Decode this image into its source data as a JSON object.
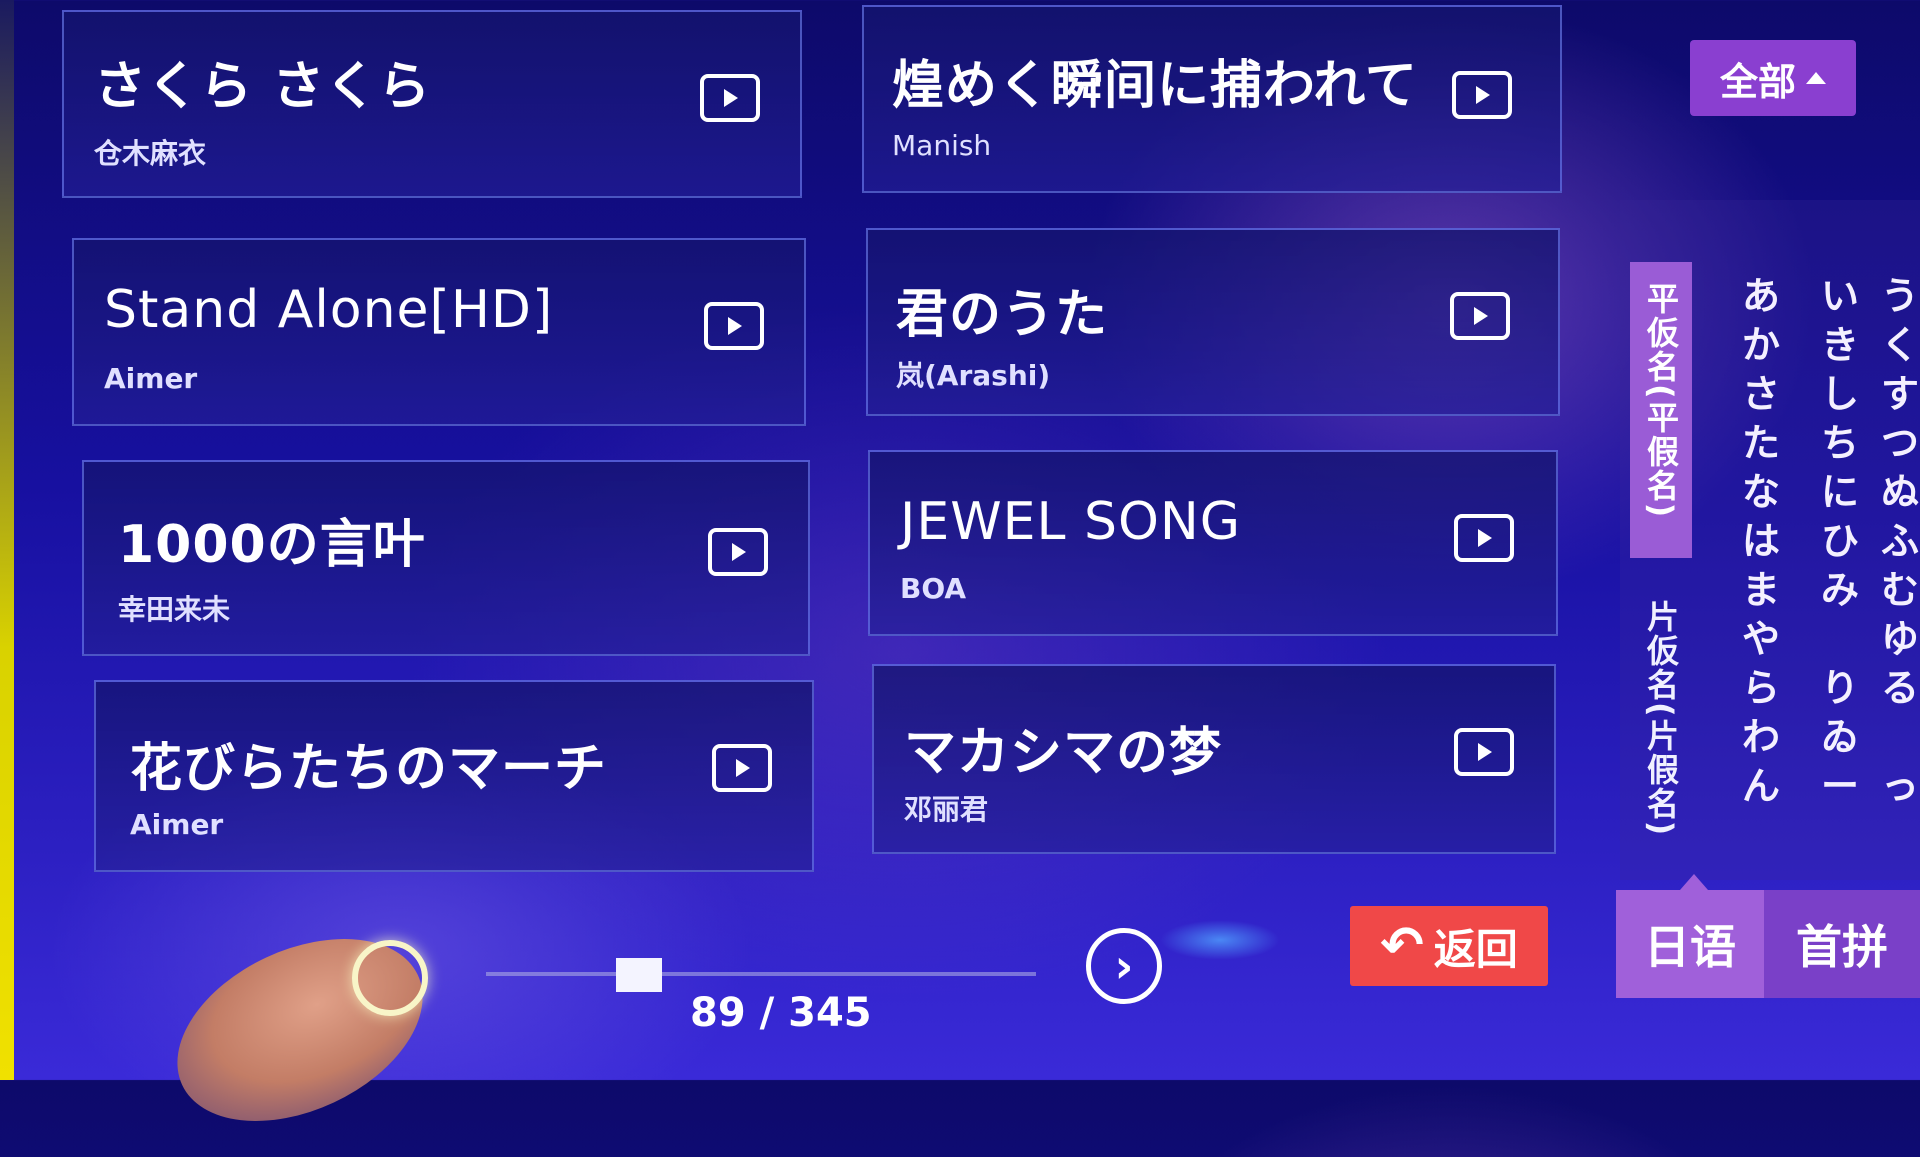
{
  "songs": [
    {
      "title": "さくら さくら",
      "artist": "仓木麻衣"
    },
    {
      "title": "煌めく瞬间に捕われて",
      "artist": "Manish"
    },
    {
      "title": "Stand Alone[HD]",
      "artist": "Aimer"
    },
    {
      "title": "君のうた",
      "artist": "岚(Arashi)"
    },
    {
      "title": "1000の言叶",
      "artist": "幸田来未"
    },
    {
      "title": "JEWEL SONG",
      "artist": "BOA"
    },
    {
      "title": "花びらたちのマーチ",
      "artist": "Aimer"
    },
    {
      "title": "マカシマの梦",
      "artist": "邓丽君"
    }
  ],
  "filter": {
    "label": "全部"
  },
  "side_panel": {
    "hiragana_tab": "平仮名(平假名)",
    "katakana_tab": "片仮名(片假名)",
    "kana_columns": [
      [
        "あ",
        "か",
        "さ",
        "た",
        "な",
        "は",
        "ま",
        "や",
        "ら",
        "わ",
        "ん"
      ],
      [
        "い",
        "き",
        "し",
        "ち",
        "に",
        "ひ",
        "み",
        "",
        "り",
        "ゐ",
        "ー"
      ],
      [
        "う",
        "く",
        "す",
        "つ",
        "ぬ",
        "ふ",
        "む",
        "ゆ",
        "る",
        "",
        "っ"
      ]
    ]
  },
  "lang_tabs": {
    "japanese": "日语",
    "pinyin": "首拼"
  },
  "back_button": {
    "label": "返回"
  },
  "pagination": {
    "current": 89,
    "total": 345,
    "text": "89 / 345"
  },
  "next_symbol": "›"
}
